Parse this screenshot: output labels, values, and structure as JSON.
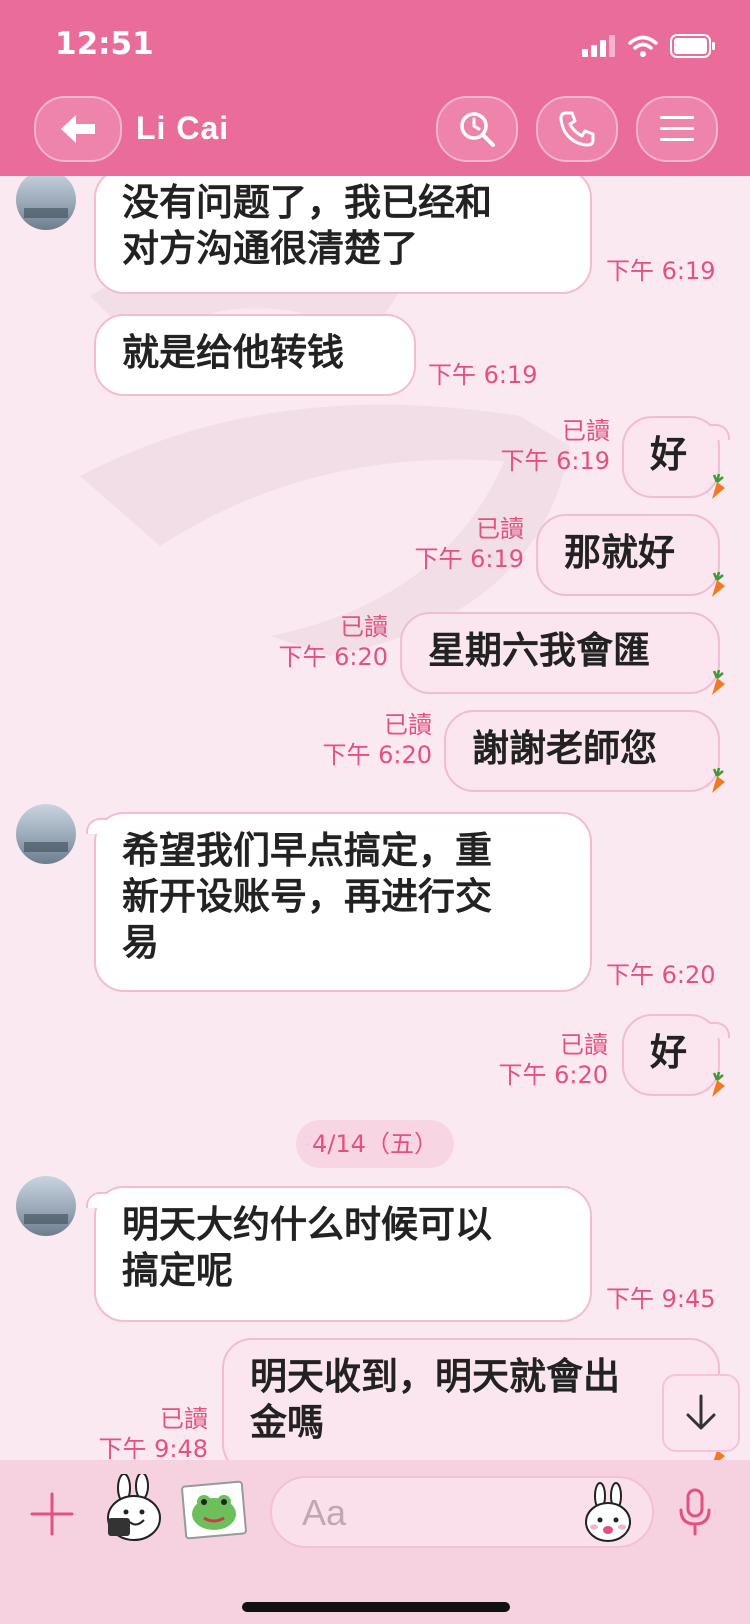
{
  "status_bar": {
    "time": "12:51"
  },
  "header": {
    "contact_name": "Li Cai"
  },
  "icons": {
    "back": "back-arrow-icon",
    "search": "search-icon",
    "call": "phone-icon",
    "menu": "menu-icon",
    "add": "plus-icon",
    "mic": "microphone-icon"
  },
  "messages": [
    {
      "direction": "in",
      "lines": [
        "没有问题了，我已经和",
        "对方沟通很清楚了"
      ],
      "time": "下午 6:19"
    },
    {
      "direction": "in",
      "lines": [
        "就是给他转钱"
      ],
      "time": "下午 6:19"
    },
    {
      "direction": "out",
      "lines": [
        "好"
      ],
      "read": "已讀",
      "time": "下午 6:19"
    },
    {
      "direction": "out",
      "lines": [
        "那就好"
      ],
      "read": "已讀",
      "time": "下午 6:19"
    },
    {
      "direction": "out",
      "lines": [
        "星期六我會匯"
      ],
      "read": "已讀",
      "time": "下午 6:20"
    },
    {
      "direction": "out",
      "lines": [
        "謝謝老師您"
      ],
      "read": "已讀",
      "time": "下午 6:20"
    },
    {
      "direction": "in",
      "lines": [
        "希望我们早点搞定，重",
        "新开设账号，再进行交",
        "易"
      ],
      "time": "下午 6:20"
    },
    {
      "direction": "out",
      "lines": [
        "好"
      ],
      "read": "已讀",
      "time": "下午 6:20"
    },
    {
      "direction": "in",
      "lines": [
        "明天大约什么时候可以",
        "搞定呢"
      ],
      "time": "下午 9:45"
    },
    {
      "direction": "out",
      "lines": [
        "明天收到，明天就會出",
        "金嗎"
      ],
      "read": "已讀",
      "time": "下午 9:48"
    }
  ],
  "date_separator": "4/14（五）",
  "input": {
    "placeholder": "Aa"
  },
  "colors": {
    "header": "#ea6c9a",
    "background": "#fbe9f1",
    "accent_text": "#e4507f",
    "bubble_border": "#f2bcd1"
  }
}
